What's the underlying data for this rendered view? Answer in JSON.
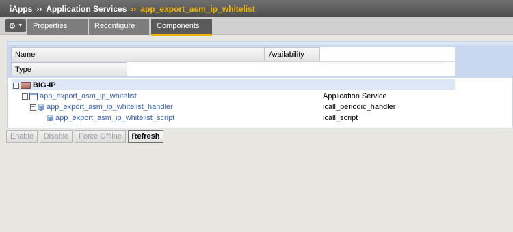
{
  "breadcrumb": {
    "items": [
      "iApps",
      "Application Services"
    ],
    "separator": "››",
    "current": "app_export_asm_ip_whitelist"
  },
  "tabs": [
    {
      "label": "Properties",
      "active": false
    },
    {
      "label": "Reconfigure",
      "active": false
    },
    {
      "label": "Components",
      "active": true
    }
  ],
  "gear_menu": {
    "icon": "gear-icon",
    "caret": "chevron-down-icon"
  },
  "table": {
    "columns": {
      "name": "Name",
      "availability": "Availability",
      "type": "Type"
    },
    "tree": [
      {
        "label": "BIG-IP",
        "type": "",
        "icon": "bigip-device-icon",
        "expander": "−",
        "level": 0
      },
      {
        "label": "app_export_asm_ip_whitelist",
        "type": "Application Service",
        "icon": "application-service-icon",
        "expander": "−",
        "level": 1
      },
      {
        "label": "app_export_asm_ip_whitelist_handler",
        "type": "icall_periodic_handler",
        "icon": "cube-icon",
        "expander": "−",
        "level": 2
      },
      {
        "label": "app_export_asm_ip_whitelist_script",
        "type": "icall_script",
        "icon": "cube-icon",
        "expander": "",
        "level": 3
      }
    ]
  },
  "buttons": [
    {
      "label": "Enable",
      "enabled": false
    },
    {
      "label": "Disable",
      "enabled": false
    },
    {
      "label": "Force Offline",
      "enabled": false
    },
    {
      "label": "Refresh",
      "enabled": true
    }
  ],
  "colors": {
    "accent": "#f0b400",
    "link": "#3861b8",
    "highlight": "#dde7f6"
  }
}
